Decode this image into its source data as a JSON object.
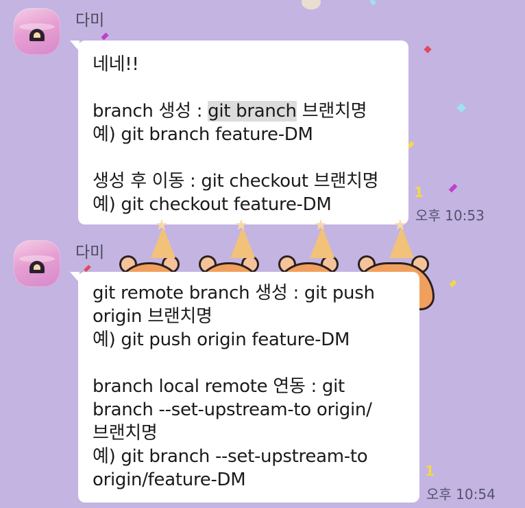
{
  "colors": {
    "background": "#c3b4e2",
    "bubble": "#ffffff",
    "highlight": "#dcdcdc",
    "time": "#55526a",
    "unread": "#f2d84a"
  },
  "messages": [
    {
      "sender": "다미",
      "unread": "1",
      "time": "오후 10:53",
      "lines": [
        "네네!!",
        "",
        "branch 생성 : ",
        "예) git branch feature-DM",
        "",
        "생성 후 이동 : git checkout 브랜치명",
        "예) git checkout feature-DM"
      ],
      "highlight": "git branch",
      "highlight_suffix": " 브랜치명"
    },
    {
      "sender": "다미",
      "unread": "1",
      "time": "오후 10:54",
      "lines": [
        "git remote branch 생성 : git push",
        "origin 브랜치명",
        "예) git push origin feature-DM",
        "",
        "branch local remote 연동 : git",
        "branch --set-upstream-to origin/",
        "브랜치명",
        "예) git branch --set-upstream-to",
        "origin/feature-DM"
      ]
    }
  ],
  "icons": {
    "avatar_icon": "profile-sunset-icon",
    "sticker": "party-hat-cat-sticker"
  }
}
